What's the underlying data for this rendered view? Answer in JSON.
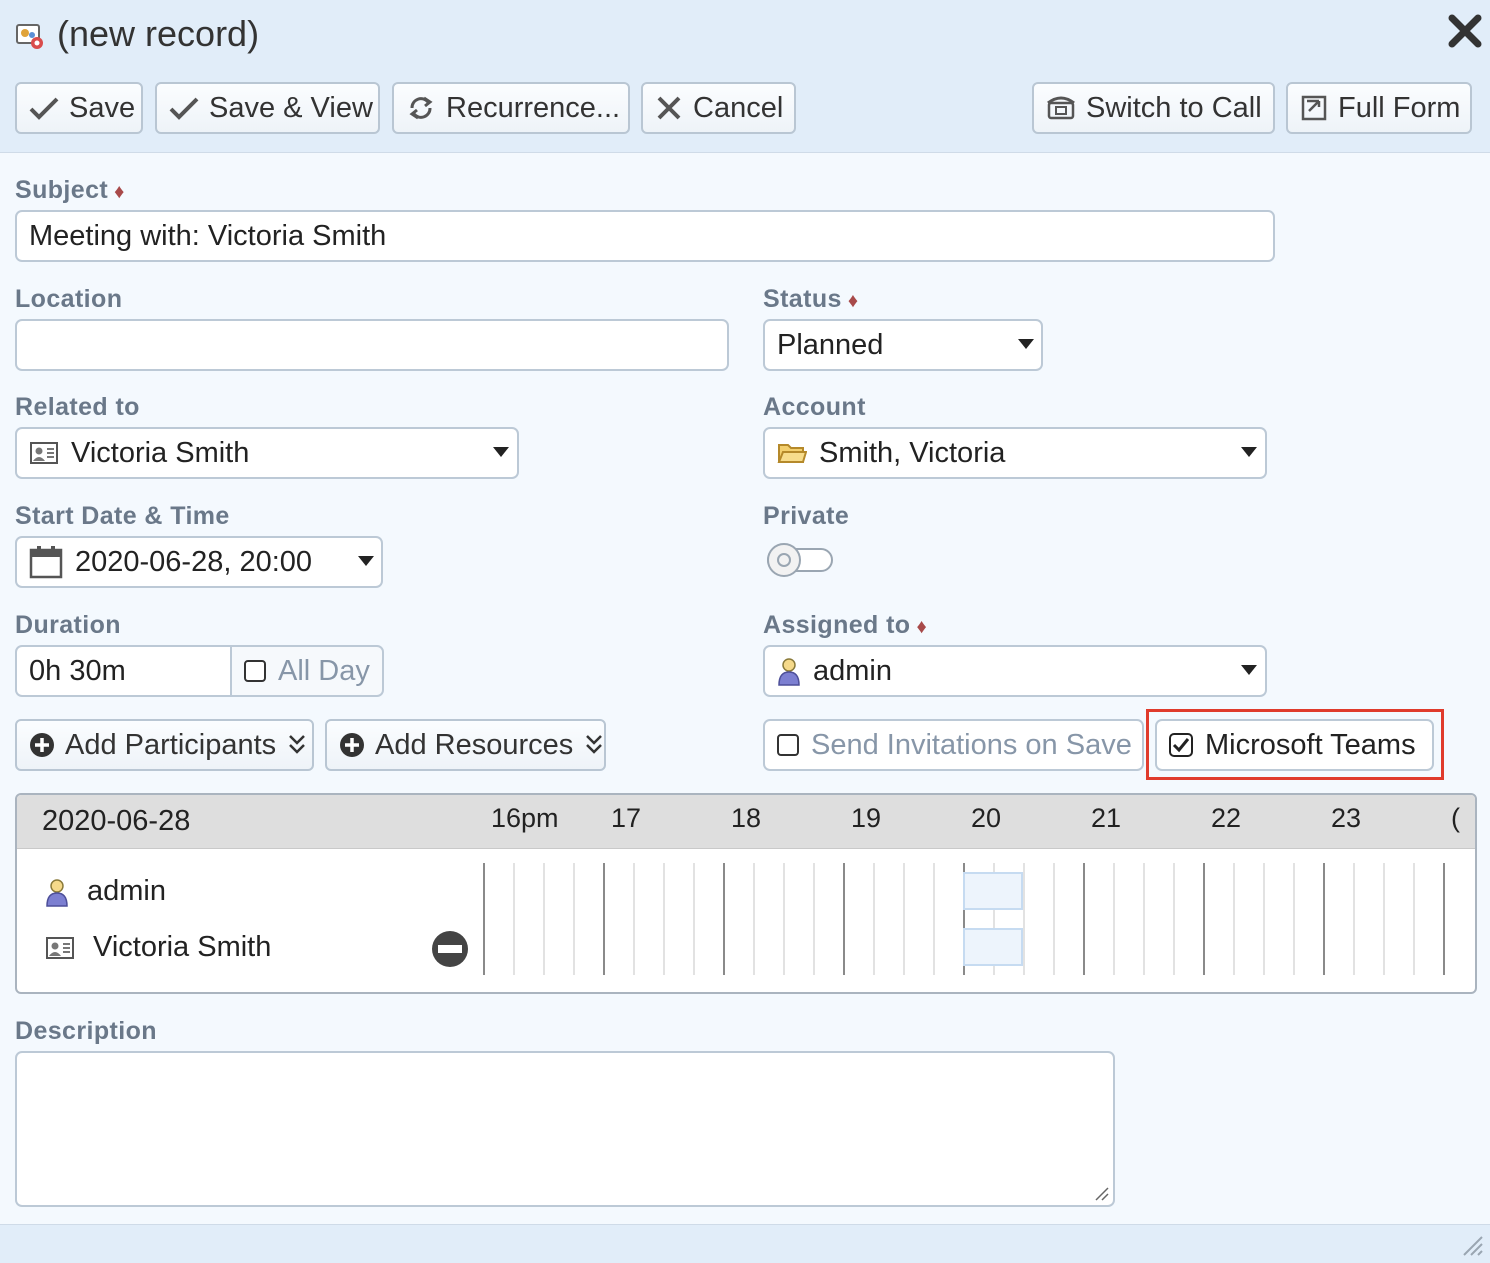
{
  "window": {
    "title": "(new record)"
  },
  "toolbar": {
    "save": "Save",
    "save_view": "Save & View",
    "recurrence": "Recurrence...",
    "cancel": "Cancel",
    "switch_to_call": "Switch to Call",
    "full_form": "Full Form"
  },
  "form": {
    "subject": {
      "label": "Subject",
      "value": "Meeting with: Victoria Smith"
    },
    "location": {
      "label": "Location",
      "value": ""
    },
    "status": {
      "label": "Status",
      "value": "Planned"
    },
    "related_to": {
      "label": "Related to",
      "value": "Victoria Smith"
    },
    "account": {
      "label": "Account",
      "value": "Smith, Victoria"
    },
    "start": {
      "label": "Start Date & Time",
      "value": "2020-06-28, 20:00"
    },
    "private": {
      "label": "Private",
      "on": false
    },
    "duration": {
      "label": "Duration",
      "value": "0h 30m",
      "all_day_label": "All Day",
      "all_day_checked": false
    },
    "assigned_to": {
      "label": "Assigned to",
      "value": "admin"
    },
    "add_participants": "Add Participants",
    "add_resources": "Add Resources",
    "send_invitations": {
      "label": "Send Invitations on Save",
      "checked": false
    },
    "microsoft_teams": {
      "label": "Microsoft Teams",
      "checked": true
    },
    "description": {
      "label": "Description",
      "value": ""
    }
  },
  "scheduler": {
    "date": "2020-06-28",
    "hours": [
      "16pm",
      "17",
      "18",
      "19",
      "20",
      "21",
      "22",
      "23",
      "("
    ],
    "participants": [
      {
        "name": "admin",
        "icon": "user-icon"
      },
      {
        "name": "Victoria Smith",
        "icon": "contact-card-icon"
      }
    ]
  },
  "colors": {
    "highlight": "#e03b2c",
    "required": "#a84a4a",
    "label": "#6a7889",
    "busy": "#edf4fc"
  }
}
